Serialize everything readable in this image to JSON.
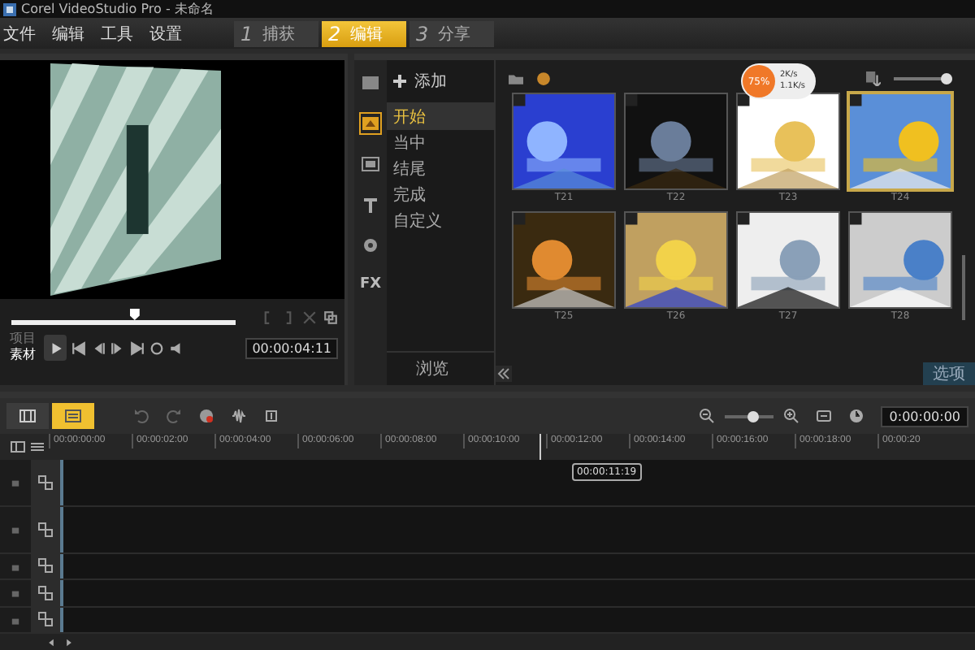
{
  "window": {
    "title": "Corel VideoStudio Pro - 未命名"
  },
  "menu": [
    "文件",
    "编辑",
    "工具",
    "设置"
  ],
  "steps": [
    {
      "number": "1",
      "label": "捕获",
      "selected": false
    },
    {
      "number": "2",
      "label": "编辑",
      "selected": true
    },
    {
      "number": "3",
      "label": "分享",
      "selected": false
    }
  ],
  "preview": {
    "level": 0.55,
    "modes": [
      {
        "label": "项目",
        "selected": false
      },
      {
        "label": "素材",
        "selected": true
      }
    ],
    "timecode": "00:00:04:11"
  },
  "library": {
    "strip_label": "FX",
    "add": "添加",
    "browse": "浏览",
    "options": "选项",
    "zoom": {
      "level": 0.92
    },
    "categories": [
      {
        "label": "开始",
        "selected": true
      },
      {
        "label": "当中",
        "selected": false
      },
      {
        "label": "结尾",
        "selected": false
      },
      {
        "label": "完成",
        "selected": false
      },
      {
        "label": "自定义",
        "selected": false
      }
    ],
    "thumbnails": [
      {
        "label": "T21",
        "selected": false
      },
      {
        "label": "T22",
        "selected": false
      },
      {
        "label": "T23",
        "selected": false
      },
      {
        "label": "T24",
        "selected": true
      },
      {
        "label": "T25",
        "selected": false
      },
      {
        "label": "T26",
        "selected": false
      },
      {
        "label": "T27",
        "selected": false
      },
      {
        "label": "T28",
        "selected": false
      }
    ]
  },
  "network_badge": {
    "percent": "75%",
    "upload": "2K/s",
    "download": "1.1K/s"
  },
  "timeline": {
    "zoom": {
      "level": 0.6
    },
    "timecode": "0:00:00:00",
    "playhead": "00:00:11:19",
    "ruler": [
      "00:00:00:00",
      "00:00:02:00",
      "00:00:04:00",
      "00:00:06:00",
      "00:00:08:00",
      "00:00:10:00",
      "00:00:12:00",
      "00:00:14:00",
      "00:00:16:00",
      "00:00:18:00",
      "00:00:20"
    ]
  }
}
